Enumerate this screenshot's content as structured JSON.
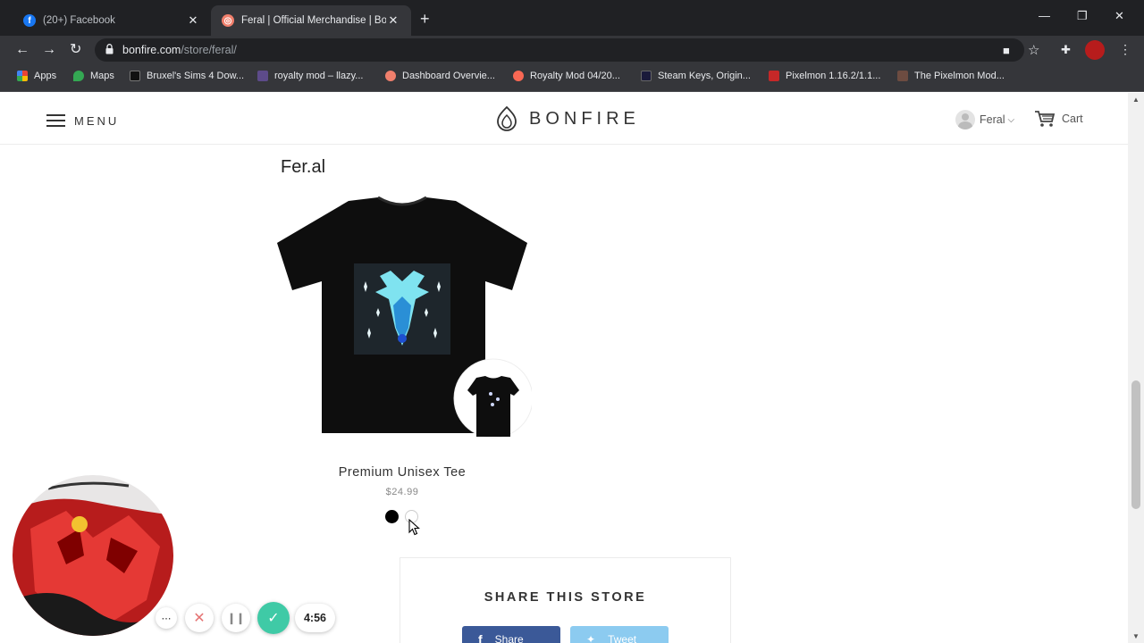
{
  "browser": {
    "tabs": [
      {
        "title": "(20+) Facebook",
        "favicon": "facebook-icon",
        "active": false
      },
      {
        "title": "Feral | Official Merchandise | Bon",
        "favicon": "bonfire-icon",
        "active": true
      }
    ],
    "url_host": "bonfire.com",
    "url_path": "/store/feral/",
    "bookmarks": [
      {
        "label": "Apps",
        "icon": "apps-grid-icon"
      },
      {
        "label": "Maps",
        "icon": "maps-pin-icon"
      },
      {
        "label": "Bruxel's Sims 4 Dow...",
        "icon": "tsr-icon"
      },
      {
        "label": "royalty mod – llazy...",
        "icon": "royalty-icon"
      },
      {
        "label": "Dashboard Overvie...",
        "icon": "bonfire-icon"
      },
      {
        "label": "Royalty Mod 04/20...",
        "icon": "patreon-icon"
      },
      {
        "label": "Steam Keys, Origin...",
        "icon": "cdkeys-icon"
      },
      {
        "label": "Pixelmon 1.16.2/1.1...",
        "icon": "pixelmon-icon"
      },
      {
        "label": "The Pixelmon Mod...",
        "icon": "pixelmon-mod-icon"
      }
    ]
  },
  "header": {
    "menu_label": "MENU",
    "logo_text": "BONFIRE",
    "user_name": "Feral",
    "cart_label": "Cart"
  },
  "store": {
    "title": "Fer.al",
    "product": {
      "name": "Premium Unisex Tee",
      "price": "$24.99",
      "swatches": [
        "#000000",
        "#ffffff"
      ]
    },
    "share": {
      "title": "SHARE THIS STORE",
      "facebook_label": "Share",
      "twitter_label": "Tweet"
    }
  },
  "recorder": {
    "time": "4:56"
  },
  "colors": {
    "chrome_dark": "#202124",
    "chrome_toolbar": "#35363a",
    "facebook": "#3b5998",
    "twitter": "#8ccbf0",
    "recorder_done": "#3fcaa6"
  }
}
